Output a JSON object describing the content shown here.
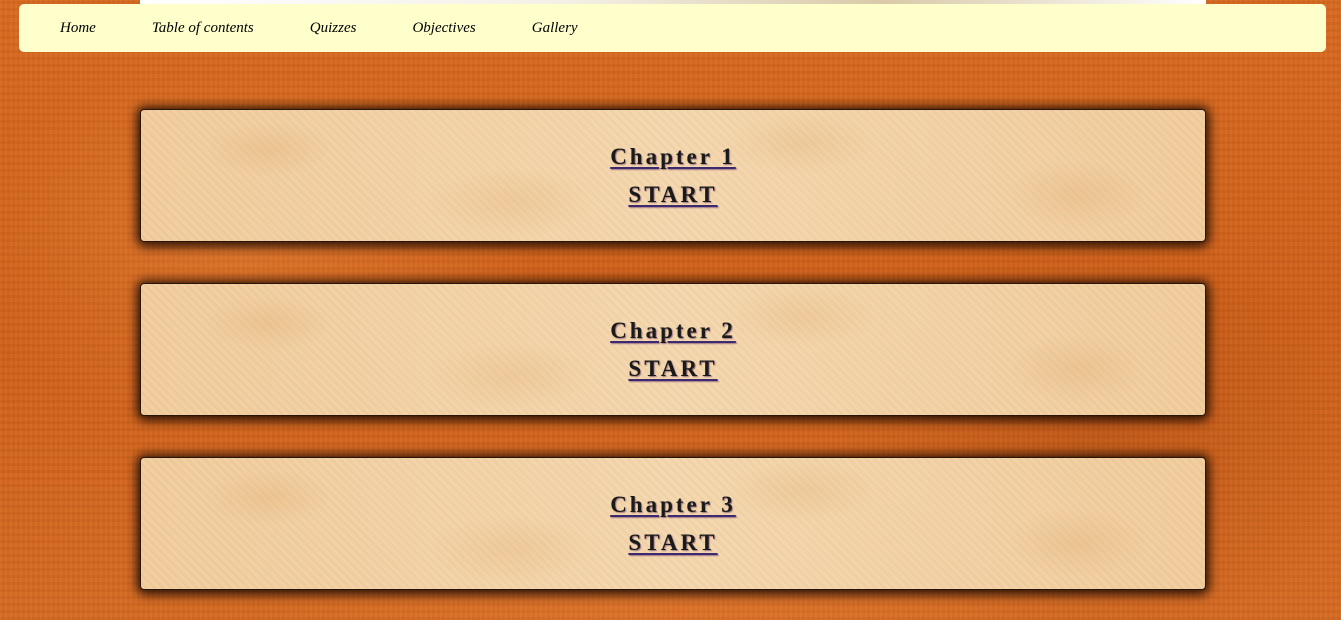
{
  "nav": {
    "items": [
      {
        "label": "Home"
      },
      {
        "label": "Table of contents"
      },
      {
        "label": "Quizzes"
      },
      {
        "label": "Objectives"
      },
      {
        "label": "Gallery"
      }
    ]
  },
  "chapters": [
    {
      "title": "Chapter 1",
      "start_label": "START"
    },
    {
      "title": "Chapter 2",
      "start_label": "START"
    },
    {
      "title": "Chapter 3",
      "start_label": "START"
    }
  ],
  "colors": {
    "page_background": "#d2641c",
    "navbar_background": "#ffffcc",
    "card_background": "#f1cfa0",
    "link_text": "#1a1a1a",
    "link_underline": "#3b2a6e"
  }
}
